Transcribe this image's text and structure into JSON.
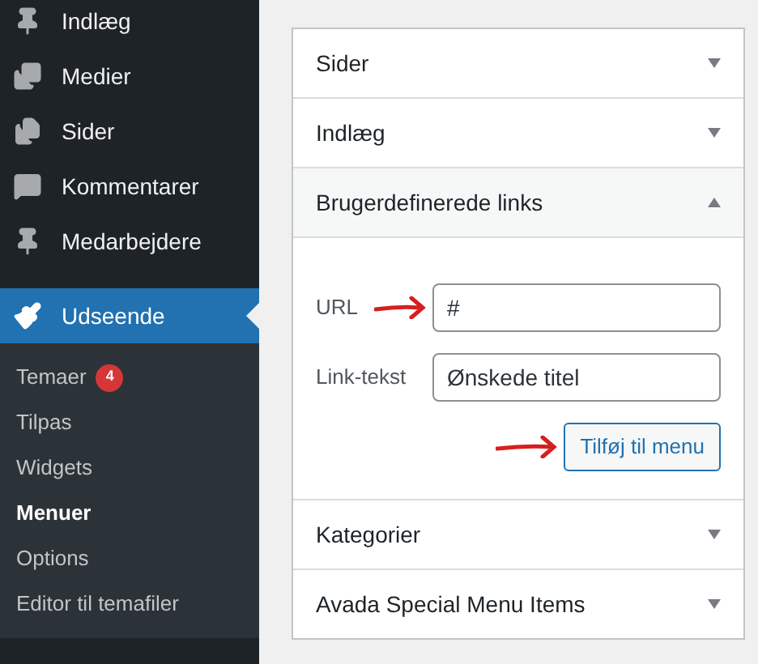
{
  "sidebar": {
    "items": [
      {
        "label": "Indlæg",
        "selected": false
      },
      {
        "label": "Medier",
        "selected": false
      },
      {
        "label": "Sider",
        "selected": false
      },
      {
        "label": "Kommentarer",
        "selected": false
      },
      {
        "label": "Medarbejdere",
        "selected": false
      },
      {
        "label": "Udseende",
        "selected": true,
        "submenu": [
          {
            "label": "Temaer",
            "badge": "4",
            "selected": false
          },
          {
            "label": "Tilpas",
            "selected": false
          },
          {
            "label": "Widgets",
            "selected": false
          },
          {
            "label": "Menuer",
            "selected": true
          },
          {
            "label": "Options",
            "selected": false
          },
          {
            "label": "Editor til temafiler",
            "selected": false
          }
        ]
      }
    ]
  },
  "panel": {
    "sections": [
      {
        "title": "Sider",
        "expanded": false
      },
      {
        "title": "Indlæg",
        "expanded": false
      },
      {
        "title": "Brugerdefinerede links",
        "expanded": true,
        "fields": [
          {
            "label": "URL",
            "value": "#"
          },
          {
            "label": "Link-tekst",
            "value": "Ønskede titel"
          }
        ],
        "button": "Tilføj til menu"
      },
      {
        "title": "Kategorier",
        "expanded": false
      },
      {
        "title": "Avada Special Menu Items",
        "expanded": false
      }
    ]
  }
}
